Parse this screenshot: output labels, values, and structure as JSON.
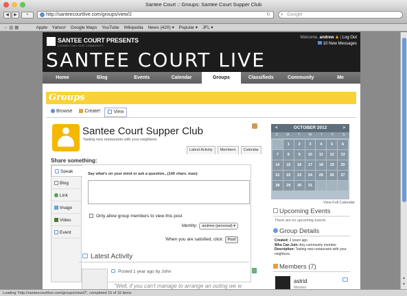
{
  "window": {
    "title": "Santee Court :: Groups: Santee Court Supper Club"
  },
  "toolbar": {
    "url": "http://santeecourtlive.com/groups/view/2",
    "search_placeholder": "Google",
    "back": "◀",
    "forward": "▶",
    "add": "+",
    "reload": "↻"
  },
  "bookmarks": [
    "Apple",
    "Yahoo!",
    "Google Maps",
    "YouTube",
    "Wikipedia",
    "News (420) ▾",
    "Popular ▾",
    "JFL ▾"
  ],
  "header": {
    "logo_small": "SANTEE COURT PRESENTS",
    "logo_tagline": "CONNECTING OUR COMMUNITY",
    "logo_big": "SANTEE COURT LIVE",
    "welcome_prefix": "Welcome,",
    "welcome_user": "andrew",
    "logout": "Log Out",
    "messages": "10 New Messages",
    "separator": "|"
  },
  "nav": [
    {
      "label": "Home"
    },
    {
      "label": "Blog"
    },
    {
      "label": "Events"
    },
    {
      "label": "Calendar"
    },
    {
      "label": "Groups"
    },
    {
      "label": "Classifieds"
    },
    {
      "label": "Community"
    },
    {
      "label": "Me"
    }
  ],
  "groups_bar": {
    "title": "Groups"
  },
  "subtabs": [
    {
      "label": "Browse"
    },
    {
      "label": "Create!"
    },
    {
      "label": "View"
    }
  ],
  "group": {
    "title": "Santee Court Supper Club",
    "description": "Tasting new restaurants with your neighbors.",
    "tabs": [
      "Latest Activity",
      "Members",
      "Calendar"
    ]
  },
  "share": {
    "title": "Share something:",
    "types": [
      "Speak",
      "Blog",
      "Link",
      "Image",
      "Video",
      "Event"
    ],
    "prompt": "Say what's on your mind or ask a question...(140 chars. max):",
    "textarea_value": "",
    "checkbox_label": "Only allow group members to view this post",
    "identity_label": "Identity:",
    "identity_value": "andrew (personal) ▾",
    "satisfied_label": "When you are satisfied, click:",
    "post_label": "Post!"
  },
  "activity": {
    "title": "Latest Activity",
    "meta": "Posted 1 year ago by John",
    "quote": "\"Well, if you can't manage to arrange an outing we w"
  },
  "calendar": {
    "month": "OCTOBER 2012",
    "prev": "<",
    "next": ">",
    "dow": [
      "S",
      "M",
      "T",
      "W",
      "T",
      "F",
      "S"
    ],
    "days": [
      "",
      "1",
      "2",
      "3",
      "4",
      "5",
      "6",
      "7",
      "8",
      "9",
      "10",
      "11",
      "12",
      "13",
      "14",
      "15",
      "16",
      "17",
      "18",
      "19",
      "20",
      "21",
      "22",
      "23",
      "24",
      "25",
      "26",
      "27",
      "28",
      "29",
      "30",
      "31",
      "",
      "",
      ""
    ],
    "view_full": "View Full Calendar"
  },
  "upcoming": {
    "title": "Upcoming Events",
    "empty": "There are no upcoming events"
  },
  "details": {
    "title": "Group Details",
    "created_label": "Created:",
    "created_value": "2 years ago",
    "who_label": "Who Can Join:",
    "who_value": "Any community member",
    "desc_label": "Description:",
    "desc_value": "Tasting new restaurants with your neighbors."
  },
  "members": {
    "title": "Members (7)",
    "first_name": "astrid",
    "first_role": "Member"
  },
  "status": {
    "text": "Loading \"http://santeecourtlive.com/groups/view/2\", completed 15 of 16 items"
  },
  "colors": {
    "accent": "#f9d23a",
    "header_bg": "#1c1c1c",
    "calendar": "#8797a3",
    "link": "#6a9ad8"
  }
}
